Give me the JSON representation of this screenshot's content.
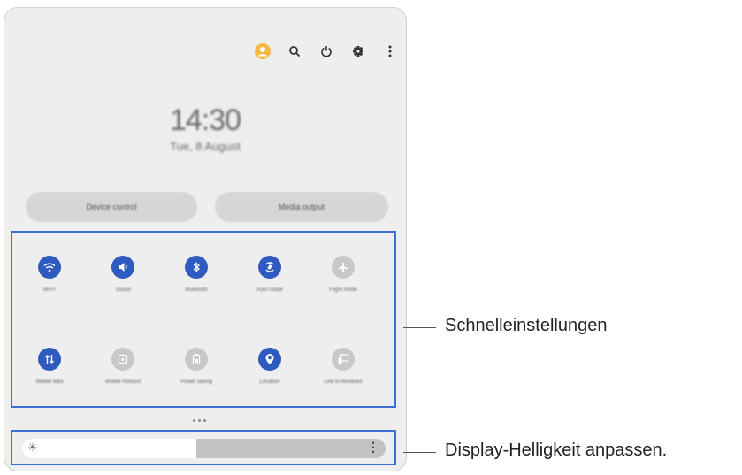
{
  "top_icons": [
    "avatar-icon",
    "search-icon",
    "power-icon",
    "gear-icon",
    "more-vertical-icon"
  ],
  "colors": {
    "accent": "#2f5bc0",
    "callout_border": "#3d6fd1",
    "avatar": "#f3b944"
  },
  "lock": {
    "time": "14:30",
    "date": "Tue, 8 August"
  },
  "buttons": {
    "device_control": "Device control",
    "media_output": "Media output"
  },
  "quick_settings": [
    {
      "label": "Wi-Fi",
      "icon": "wifi-icon",
      "active": true
    },
    {
      "label": "Sound",
      "icon": "volume-icon",
      "active": true
    },
    {
      "label": "Bluetooth",
      "icon": "bluetooth-icon",
      "active": true
    },
    {
      "label": "Auto rotate",
      "icon": "auto-rotate-icon",
      "active": true
    },
    {
      "label": "Flight mode",
      "icon": "airplane-icon",
      "active": false
    },
    {
      "label": "Mobile data",
      "icon": "data-arrows-icon",
      "active": true
    },
    {
      "label": "Mobile Hotspot",
      "icon": "hotspot-icon",
      "active": false
    },
    {
      "label": "Power saving",
      "icon": "battery-icon",
      "active": false
    },
    {
      "label": "Location",
      "icon": "location-pin-icon",
      "active": true
    },
    {
      "label": "Link to Windows",
      "icon": "link-windows-icon",
      "active": false
    }
  ],
  "brightness": {
    "level": 0.48
  },
  "callouts": {
    "quick_settings": "Schnelleinstellungen",
    "brightness": "Display-Helligkeit anpassen."
  }
}
